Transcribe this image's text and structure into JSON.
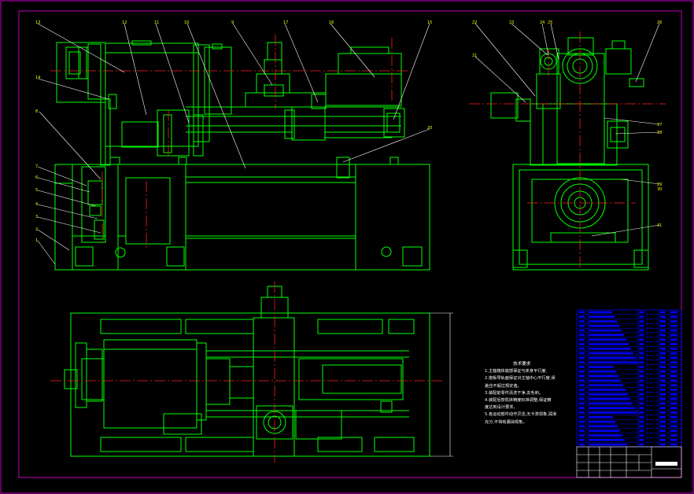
{
  "colors": {
    "background": "#000000",
    "frame": "#c000c0",
    "outline": "#00ff00",
    "centerline": "#ff2020",
    "leader": "#ffffff",
    "table": "#0000ff",
    "label": "#ffff00"
  },
  "callouts_front": [
    "13",
    "12",
    "11",
    "10",
    "9",
    "17",
    "16",
    "15",
    "14",
    "8",
    "7",
    "6",
    "5",
    "4",
    "3",
    "2",
    "1",
    "20"
  ],
  "callouts_side": [
    "22",
    "23",
    "24",
    "25",
    "26",
    "21",
    "27",
    "28",
    "29",
    "30",
    "31"
  ],
  "tech_notes": {
    "title": "技术要求",
    "lines": [
      "1.主轴箱体底部保证与床身平行度,",
      "2.拖板导轨面保证对主轴中心平行度,误",
      "差应不超过规定值。",
      "3.装配前零件清洗干净,去毛刺。",
      "4.装配后按机床精度标准调整,保证精",
      "度达到设计要求。",
      "5.各运动部件动作灵活,无卡滞现象,润滑",
      "充分,不得有漏油现象。"
    ]
  }
}
